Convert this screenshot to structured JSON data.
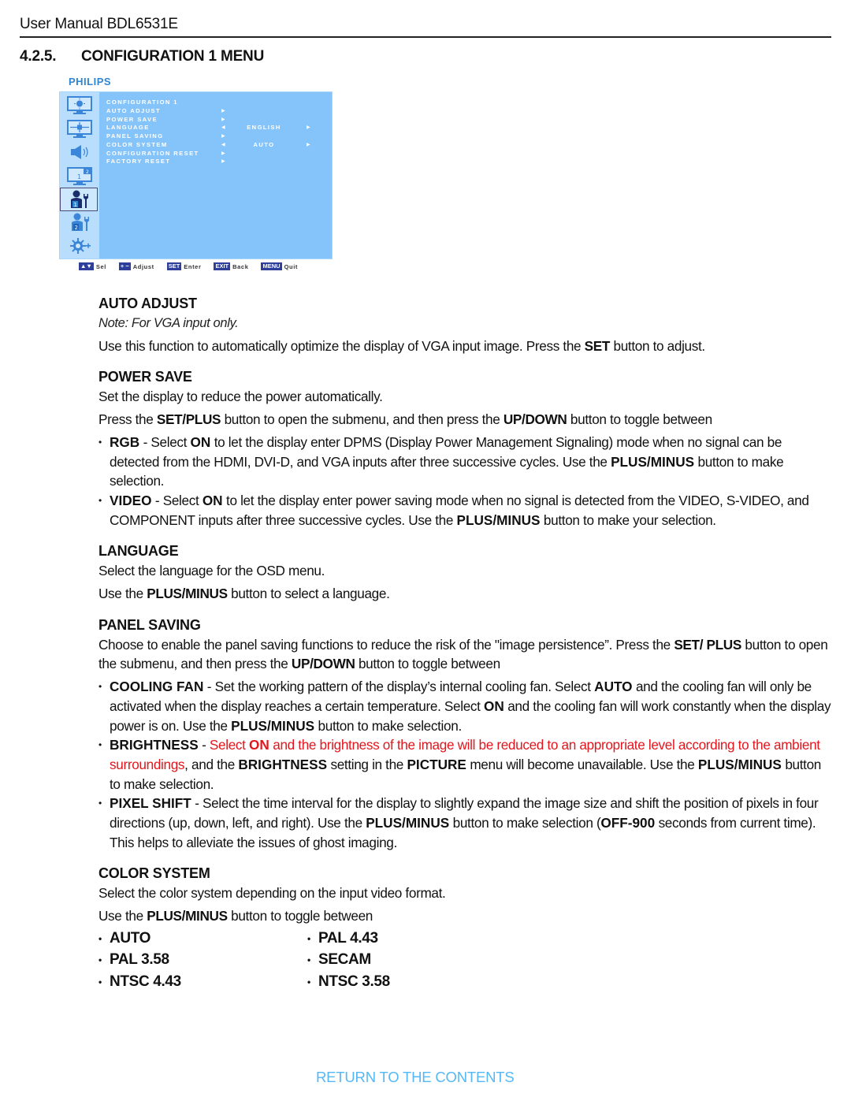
{
  "header": {
    "title": "User Manual BDL6531E"
  },
  "section": {
    "number": "4.2.5.",
    "title": "CONFIGURATION 1 MENU"
  },
  "osd": {
    "brand": "PHILIPS",
    "sidebar_icons": [
      {
        "name": "picture-icon",
        "active": false
      },
      {
        "name": "screen-icon",
        "active": false
      },
      {
        "name": "audio-icon",
        "active": false
      },
      {
        "name": "pip-icon",
        "active": false
      },
      {
        "name": "configuration-1-icon",
        "active": true
      },
      {
        "name": "configuration-2-icon",
        "active": false
      },
      {
        "name": "advanced-option-icon",
        "active": false
      }
    ],
    "menu_title": "CONFIGURATION 1",
    "menu_items": [
      {
        "label": "AUTO ADJUST",
        "arrow": "▶",
        "value": "",
        "arrow_right": ""
      },
      {
        "label": "POWER SAVE",
        "arrow": "▶",
        "value": "",
        "arrow_right": ""
      },
      {
        "label": "LANGUAGE",
        "arrow": "◀",
        "value": "ENGLISH",
        "arrow_right": "▶"
      },
      {
        "label": "PANEL SAVING",
        "arrow": "▶",
        "value": "",
        "arrow_right": ""
      },
      {
        "label": "COLOR SYSTEM",
        "arrow": "◀",
        "value": "AUTO",
        "arrow_right": "▶"
      },
      {
        "label": "CONFIGURATION RESET",
        "arrow": "▶",
        "value": "",
        "arrow_right": ""
      },
      {
        "label": "FACTORY RESET",
        "arrow": "▶",
        "value": "",
        "arrow_right": ""
      }
    ],
    "legend": [
      {
        "key": "▲▼",
        "label": "Sel"
      },
      {
        "key": "+ −",
        "label": "Adjust"
      },
      {
        "key": "SET",
        "label": "Enter"
      },
      {
        "key": "EXIT",
        "label": "Back"
      },
      {
        "key": "MENU",
        "label": "Quit"
      }
    ]
  },
  "auto_adjust": {
    "heading": "AUTO ADJUST",
    "note": "Note: For VGA input only.",
    "text_1": "Use this function to automatically optimize the display of VGA input image. Press the ",
    "text_bold": "SET",
    "text_2": " button to adjust."
  },
  "power_save": {
    "heading": "POWER SAVE",
    "p1": "Set the display to reduce the power automatically.",
    "p2_a": "Press the ",
    "p2_b": "SET/PLUS",
    "p2_c": " button to open the submenu, and then press the ",
    "p2_d": "UP/DOWN",
    "p2_e": " button to toggle between",
    "rgb": {
      "term": "RGB",
      "a": " - Select ",
      "b": "ON",
      "c": " to let the display enter DPMS (Display Power Management Signaling) mode when no signal can be detected from the HDMI, DVI-D, and VGA inputs after three successive cycles. Use the ",
      "d": "PLUS/MINUS",
      "e": " button to make selection."
    },
    "video": {
      "term": "VIDEO",
      "a": " - Select ",
      "b": "ON",
      "c": " to let the display enter power saving mode when no signal is detected from the VIDEO, S-VIDEO, and COMPONENT inputs after three successive cycles. Use the ",
      "d": "PLUS/MINUS",
      "e": " button to make your selection."
    }
  },
  "language": {
    "heading": "LANGUAGE",
    "p1": "Select the language for the OSD menu.",
    "p2_a": "Use the ",
    "p2_b": "PLUS/MINUS",
    "p2_c": " button to select a language."
  },
  "panel_saving": {
    "heading": "PANEL SAVING",
    "p1_a": "Choose to enable the panel saving functions to reduce the risk of the \"image persistence”. Press the ",
    "p1_b": "SET/ PLUS",
    "p1_c": " button to open the submenu, and then press the ",
    "p1_d": "UP/DOWN",
    "p1_e": " button to toggle between",
    "cooling_fan": {
      "term": "COOLING FAN",
      "a": " - Set the working pattern of the display’s internal cooling fan. Select ",
      "b": "AUTO",
      "c": " and the cooling fan will only be activated when the display reaches a certain temperature. Select ",
      "d": "ON",
      "e": " and the cooling fan will work constantly when the display power is on. Use the ",
      "f": "PLUS/MINUS",
      "g": " button to make selection."
    },
    "brightness": {
      "term": "BRIGHTNESS",
      "a": " - ",
      "red_a": "Select ",
      "red_b": "ON",
      "red_c": " and the brightness of the image will be reduced to an appropriate level according to the ambient surroundings",
      "b": ", and the ",
      "c": "BRIGHTNESS",
      "d": " setting in the ",
      "e": "PICTURE",
      "f": " menu will become unavailable. Use the ",
      "g": "PLUS/MINUS",
      "h": " button to make selection."
    },
    "pixel_shift": {
      "term": "PIXEL SHIFT",
      "a": " - Select the time interval for the display to slightly expand the image size and shift the position of pixels in four directions (up, down, left, and right). Use the ",
      "b": "PLUS/MINUS",
      "c": " button to make selection (",
      "d": "OFF-900",
      "e": " seconds from current time). This helps to alleviate the issues of ghost imaging."
    }
  },
  "color_system": {
    "heading": "COLOR SYSTEM",
    "p1": "Select the color system depending on the input video format.",
    "p2_a": "Use the ",
    "p2_b": "PLUS/MINUS",
    "p2_c": " button to toggle between",
    "options": [
      "AUTO",
      "PAL 4.43",
      "PAL 3.58",
      "SECAM",
      "NTSC 4.43",
      "NTSC 3.58"
    ]
  },
  "footer": {
    "return_link": "RETURN TO THE CONTENTS"
  },
  "colors": {
    "osd_background": "#85c4fa",
    "osd_sidebar": "#b9defd",
    "brand_blue": "#2f86d3",
    "highlight_red": "#e3161d",
    "link_blue": "#55b8f5"
  }
}
